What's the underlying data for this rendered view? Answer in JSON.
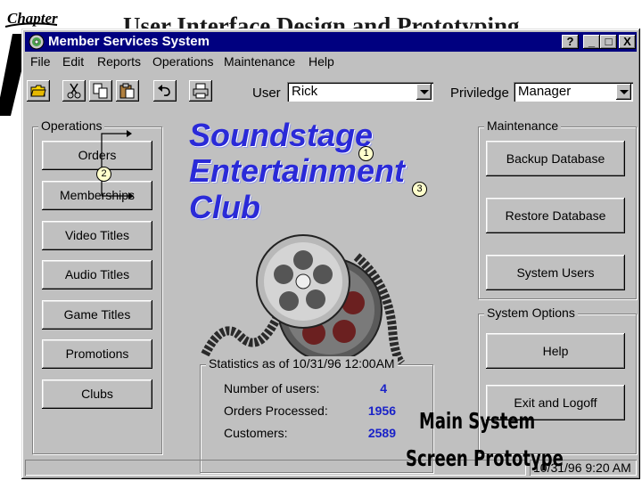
{
  "slide": {
    "title": "User Interface Design and Prototyping",
    "logo_text": "Chapter"
  },
  "window": {
    "title": "Member Services System",
    "controls": [
      "?",
      "_",
      "□",
      "X"
    ]
  },
  "menu": [
    "File",
    "Edit",
    "Reports",
    "Operations",
    "Maintenance",
    "Help"
  ],
  "toolbar": {
    "icons": [
      "open-folder-icon",
      "cut-icon",
      "copy-icon",
      "paste-icon",
      "undo-icon",
      "print-icon"
    ],
    "user_label": "User",
    "user_value": "Rick",
    "privilege_label": "Priviledge",
    "privilege_value": "Manager"
  },
  "operations": {
    "title": "Operations",
    "buttons": [
      "Orders",
      "Memberships",
      "Video Titles",
      "Audio Titles",
      "Game Titles",
      "Promotions",
      "Clubs"
    ]
  },
  "logo": {
    "line1": "Soundstage",
    "line2": "Entertainment",
    "line3": "Club"
  },
  "callouts": [
    "1",
    "2",
    "3"
  ],
  "statistics": {
    "title": "Statistics as of 10/31/96 12:00AM",
    "rows": [
      {
        "label": "Number of users:",
        "value": "4"
      },
      {
        "label": "Orders Processed:",
        "value": "1956"
      },
      {
        "label": "Customers:",
        "value": "2589"
      }
    ]
  },
  "maintenance": {
    "title": "Maintenance",
    "buttons": [
      "Backup Database",
      "Restore Database",
      "System Users"
    ]
  },
  "system_options": {
    "title": "System Options",
    "buttons": [
      "Help",
      "Exit and Logoff"
    ]
  },
  "statusbar": {
    "left": "",
    "right": "10/31/96 9:20 AM"
  },
  "caption": {
    "line1": "Main System",
    "line2": "Screen Prototype"
  },
  "colors": {
    "titlebar": "#000080",
    "face": "#c0c0c0",
    "logo_text": "#2a2ad8",
    "stat_value": "#1a22c8"
  }
}
